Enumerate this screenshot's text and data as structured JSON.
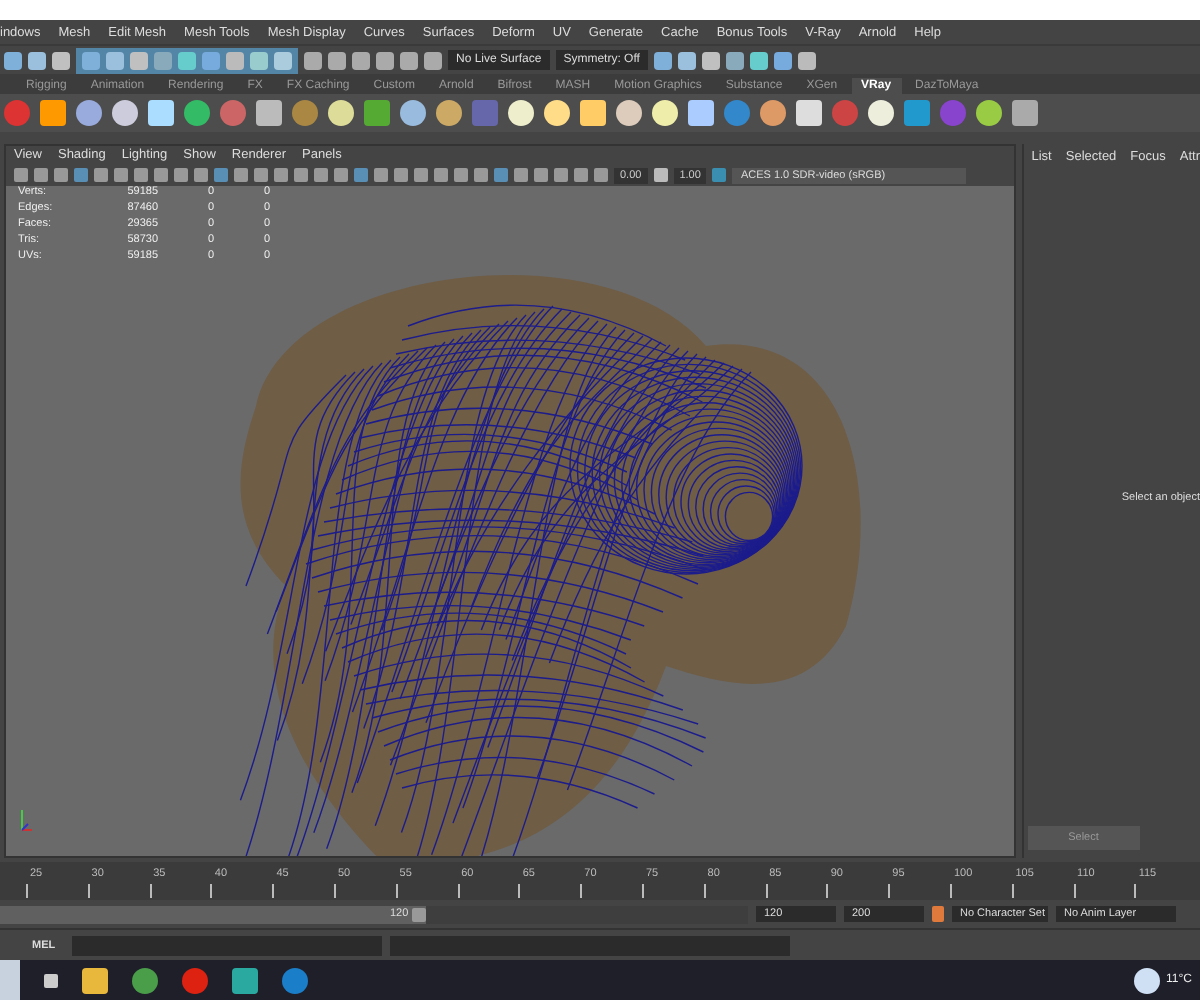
{
  "menu_bar": {
    "items": [
      "indows",
      "Mesh",
      "Edit Mesh",
      "Mesh Tools",
      "Mesh Display",
      "Curves",
      "Surfaces",
      "Deform",
      "UV",
      "Generate",
      "Cache",
      "Bonus Tools",
      "V-Ray",
      "Arnold",
      "Help"
    ]
  },
  "status_line": {
    "live_surface": "No Live Surface",
    "symmetry": "Symmetry: Off"
  },
  "shelf": {
    "tabs": [
      {
        "label": "Rigging",
        "selected": false
      },
      {
        "label": "Animation",
        "selected": false
      },
      {
        "label": "Rendering",
        "selected": false
      },
      {
        "label": "FX",
        "selected": false
      },
      {
        "label": "FX Caching",
        "selected": false
      },
      {
        "label": "Custom",
        "selected": false
      },
      {
        "label": "Arnold",
        "selected": false
      },
      {
        "label": "Bifrost",
        "selected": false
      },
      {
        "label": "MASH",
        "selected": false
      },
      {
        "label": "Motion Graphics",
        "selected": false
      },
      {
        "label": "Substance",
        "selected": false
      },
      {
        "label": "XGen",
        "selected": false
      },
      {
        "label": "VRay",
        "selected": true
      },
      {
        "label": "DazToMaya",
        "selected": false
      }
    ]
  },
  "viewport": {
    "menu": [
      "View",
      "Shading",
      "Lighting",
      "Show",
      "Renderer",
      "Panels"
    ],
    "exposure": "0.00",
    "gamma": "1.00",
    "color_space": "ACES 1.0 SDR-video (sRGB)",
    "stats": [
      {
        "label": "Verts:",
        "values": [
          "59185",
          "0",
          "0"
        ]
      },
      {
        "label": "Edges:",
        "values": [
          "87460",
          "0",
          "0"
        ]
      },
      {
        "label": "Faces:",
        "values": [
          "29365",
          "0",
          "0"
        ]
      },
      {
        "label": "Tris:",
        "values": [
          "58730",
          "0",
          "0"
        ]
      },
      {
        "label": "UVs:",
        "values": [
          "59185",
          "0",
          "0"
        ]
      }
    ]
  },
  "attribute_panel": {
    "menu": [
      "List",
      "Selected",
      "Focus",
      "Attr"
    ],
    "message": "Select an object",
    "button": "Select"
  },
  "time_slider": {
    "ticks": [
      "25",
      "30",
      "35",
      "40",
      "45",
      "50",
      "55",
      "60",
      "65",
      "70",
      "75",
      "80",
      "85",
      "90",
      "95",
      "100",
      "105",
      "110",
      "115"
    ]
  },
  "range_slider": {
    "level": 0.57,
    "handle_value": "120",
    "end": "120",
    "max": "200",
    "character_set": "No Character Set",
    "anim_layer": "No Anim Layer"
  },
  "command_line": {
    "language": "MEL"
  },
  "taskbar": {
    "temperature": "11°C"
  }
}
